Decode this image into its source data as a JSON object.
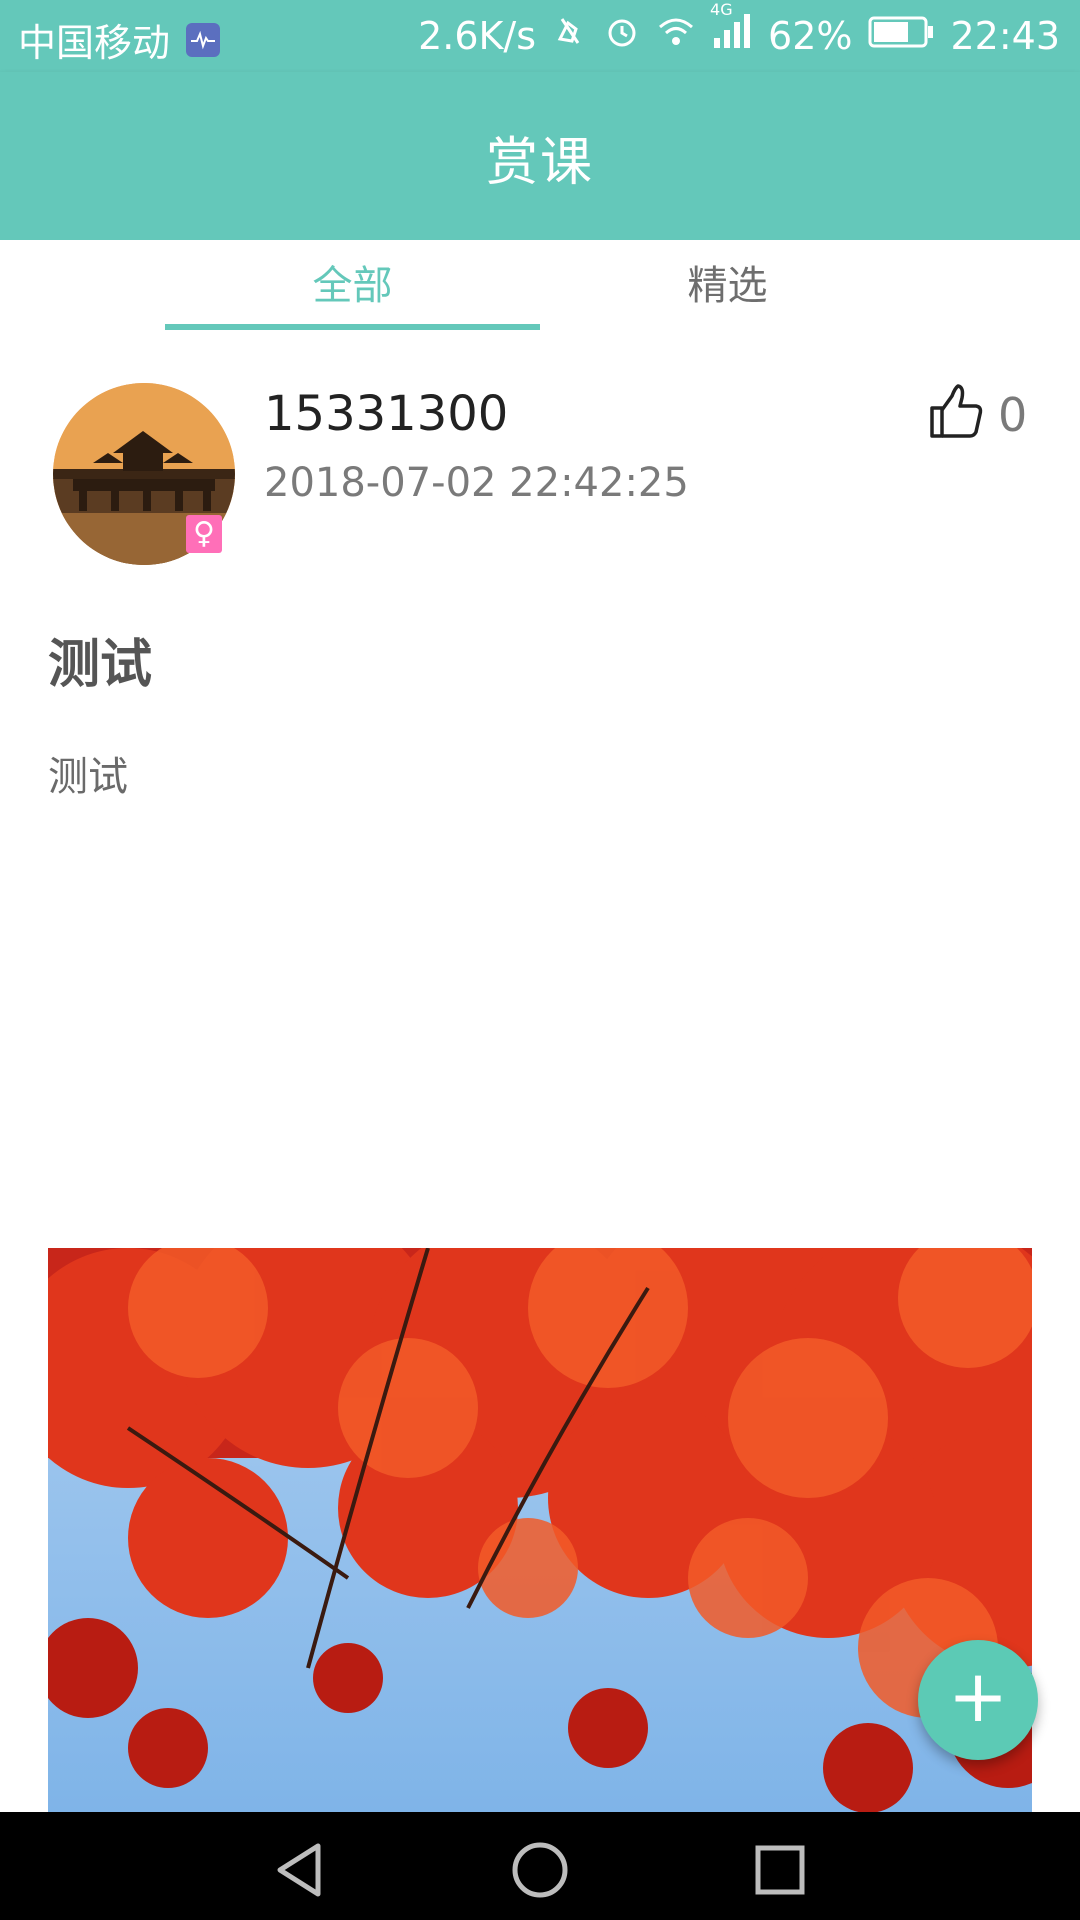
{
  "status_bar": {
    "carrier": "中国移动",
    "speed": "2.6K/s",
    "network": "4G",
    "battery": "62%",
    "time": "22:43",
    "icons": [
      "heart-monitor-icon",
      "mute-icon",
      "alarm-icon",
      "wifi-icon",
      "signal-icon",
      "battery-icon"
    ]
  },
  "app_bar": {
    "title": "赏课"
  },
  "tabs": [
    {
      "label": "全部",
      "active": true
    },
    {
      "label": "精选",
      "active": false
    }
  ],
  "post": {
    "username": "15331300",
    "timestamp": "2018-07-02 22:42:25",
    "like_count": "0",
    "gender_symbol": "♀",
    "title": "测试",
    "body": "测试"
  },
  "fab": {
    "icon": "plus-icon",
    "label": "+"
  },
  "colors": {
    "primary": "#64c8ba",
    "fab": "#5ccab5",
    "gender_female": "#ff6fb8"
  },
  "nav_bar": {
    "icons": [
      "back-icon",
      "home-icon",
      "recents-icon"
    ]
  }
}
